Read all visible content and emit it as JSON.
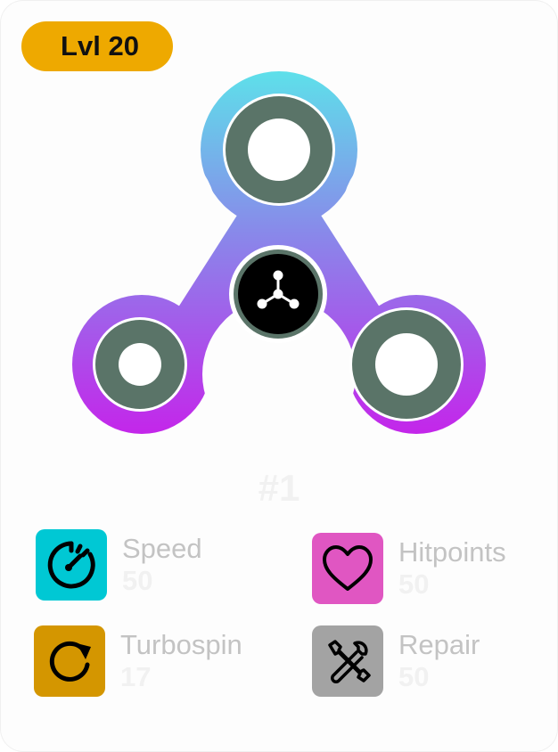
{
  "level": {
    "label": "Lvl 20",
    "color": "#eea900"
  },
  "spinner": {
    "gradient_top": "#5ee0ea",
    "gradient_mid": "#8a86ea",
    "gradient_bottom": "#c622ea",
    "bearing_color": "#5a7468",
    "center_color": "#000000",
    "center_icon": "molecule-icon"
  },
  "rank": "#1",
  "stats": [
    {
      "label": "Speed",
      "value": "50",
      "icon": "speedometer-icon",
      "color": "#00c8d4"
    },
    {
      "label": "Hitpoints",
      "value": "50",
      "icon": "heart-icon",
      "color": "#e056c2"
    },
    {
      "label": "Turbospin",
      "value": "17",
      "icon": "refresh-icon",
      "color": "#d49600"
    },
    {
      "label": "Repair",
      "value": "50",
      "icon": "tools-icon",
      "color": "#a3a3a3"
    }
  ]
}
